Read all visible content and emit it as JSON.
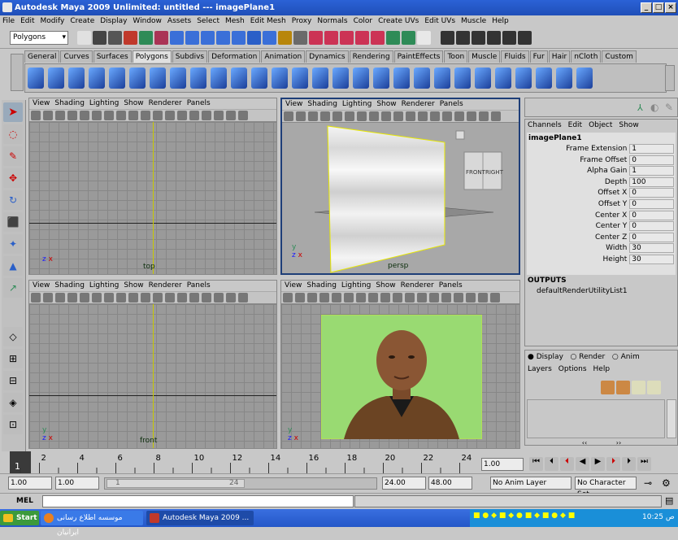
{
  "window": {
    "title": "Autodesk Maya 2009 Unlimited: untitled  ---  imagePlane1"
  },
  "menubar": [
    "File",
    "Edit",
    "Modify",
    "Create",
    "Display",
    "Window",
    "Assets",
    "Select",
    "Mesh",
    "Edit Mesh",
    "Proxy",
    "Normals",
    "Color",
    "Create UVs",
    "Edit UVs",
    "Muscle",
    "Help"
  ],
  "statusline": {
    "mode": "Polygons"
  },
  "shelf": {
    "tabs": [
      "General",
      "Curves",
      "Surfaces",
      "Polygons",
      "Subdivs",
      "Deformation",
      "Animation",
      "Dynamics",
      "Rendering",
      "PaintEffects",
      "Toon",
      "Muscle",
      "Fluids",
      "Fur",
      "Hair",
      "nCloth",
      "Custom"
    ],
    "active_tab": "Polygons"
  },
  "panel_menu": [
    "View",
    "Shading",
    "Lighting",
    "Show",
    "Renderer",
    "Panels"
  ],
  "viewports": {
    "top": {
      "label": "top"
    },
    "persp": {
      "label": "persp",
      "cube_front": "FRONT",
      "cube_right": "RIGHT"
    },
    "front": {
      "label": "front"
    },
    "side": {
      "label": ""
    }
  },
  "channelbox": {
    "menu": [
      "Channels",
      "Edit",
      "Object",
      "Show"
    ],
    "node": "imagePlane1",
    "attrs": [
      {
        "name": "Frame Extension",
        "value": "1"
      },
      {
        "name": "Frame Offset",
        "value": "0"
      },
      {
        "name": "Alpha Gain",
        "value": "1"
      },
      {
        "name": "Depth",
        "value": "100"
      },
      {
        "name": "Offset X",
        "value": "0"
      },
      {
        "name": "Offset Y",
        "value": "0"
      },
      {
        "name": "Center X",
        "value": "0"
      },
      {
        "name": "Center Y",
        "value": "0"
      },
      {
        "name": "Center Z",
        "value": "0"
      },
      {
        "name": "Width",
        "value": "30"
      },
      {
        "name": "Height",
        "value": "30"
      }
    ],
    "outputs_label": "OUTPUTS",
    "output_node": "defaultRenderUtilityList1"
  },
  "layers": {
    "radios": [
      "Display",
      "Render",
      "Anim"
    ],
    "menu": [
      "Layers",
      "Options",
      "Help"
    ]
  },
  "timeslider": {
    "ticks": [
      "2",
      "4",
      "6",
      "8",
      "10",
      "12",
      "14",
      "16",
      "18",
      "20",
      "22",
      "24"
    ],
    "current_frame": "1",
    "current_field": "1.00"
  },
  "range": {
    "start": "1.00",
    "playback_start": "1.00",
    "slider_start": "1",
    "slider_end": "24",
    "playback_end": "24.00",
    "end": "48.00",
    "anim_layer": "No Anim Layer",
    "character": "No Character Set"
  },
  "mel": {
    "label": "MEL"
  },
  "taskbar": {
    "start": "Start",
    "items": [
      "موسسه اطلاع رسانی ایرانیان",
      "Autodesk Maya 2009 ..."
    ],
    "clock": "10:25 ص"
  }
}
